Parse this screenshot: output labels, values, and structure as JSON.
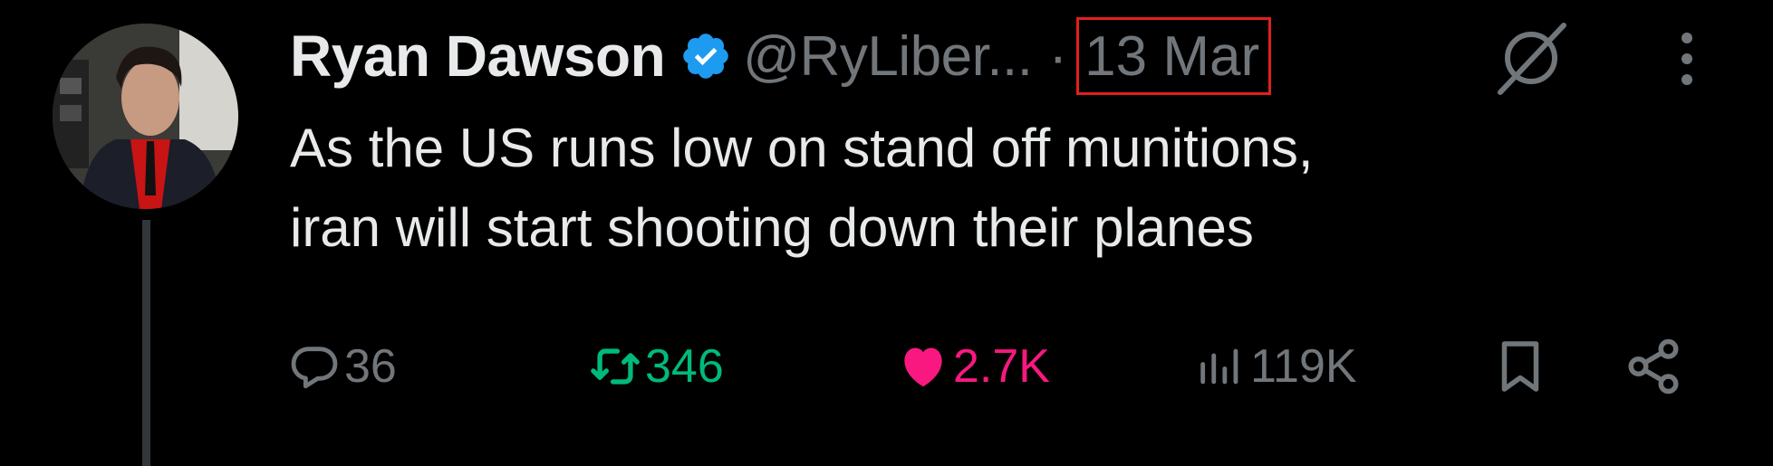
{
  "author": {
    "name": "Ryan Dawson",
    "handle": "@RyLiber...",
    "verified": true
  },
  "timestamp": {
    "separator": "·",
    "label": "13 Mar"
  },
  "tweet": {
    "lines": [
      "As the US runs low on stand off munitions,",
      "iran will start shooting down their planes"
    ]
  },
  "actions": {
    "replies": "36",
    "retweets": "346",
    "likes": "2.7K",
    "views": "119K"
  },
  "icons": {
    "verified": "verified-badge-icon",
    "grok": "grok-icon",
    "more": "more-icon",
    "reply": "reply-icon",
    "retweet": "retweet-icon",
    "like": "heart-icon",
    "views": "views-icon",
    "bookmark": "bookmark-icon",
    "share": "share-icon"
  },
  "colors": {
    "background": "#000000",
    "text": "#e7e9ea",
    "muted": "#71767b",
    "verified": "#1d9bf0",
    "retweet": "#00ba7c",
    "like": "#f91880",
    "highlight_box": "#e0201e"
  }
}
